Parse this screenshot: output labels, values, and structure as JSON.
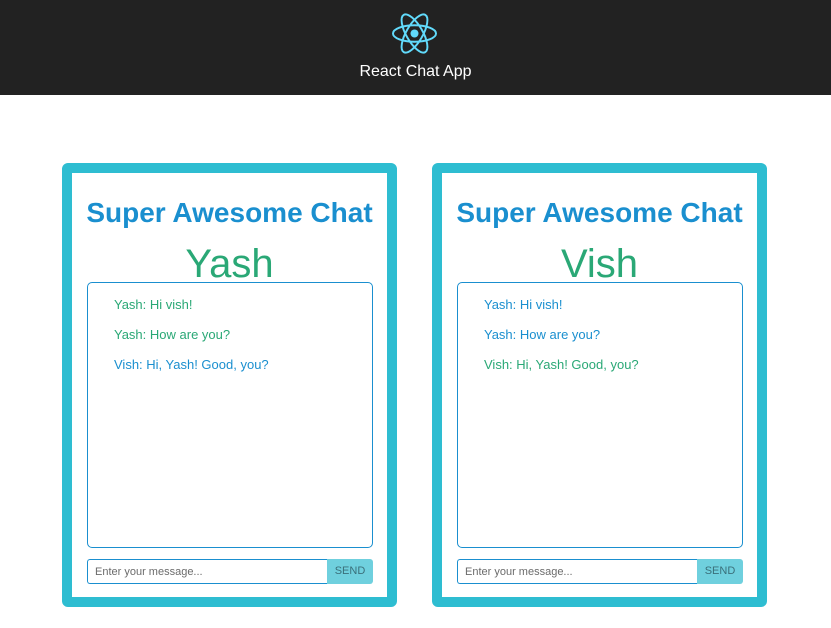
{
  "header": {
    "title": "React Chat App",
    "logo_icon": "react-atom-icon",
    "background": "#222222",
    "logo_color": "#61dafb"
  },
  "colors": {
    "card_border": "#2ebdd1",
    "heading": "#1a8fcf",
    "user_name": "#2aa876",
    "send_button": "#6fd0de"
  },
  "chats": [
    {
      "heading": "Super Awesome Chat",
      "user": "Yash",
      "messages": [
        {
          "text": "Yash: Hi vish!",
          "sender": "Yash"
        },
        {
          "text": "Yash: How are you?",
          "sender": "Yash"
        },
        {
          "text": "Vish: Hi, Yash! Good, you?",
          "sender": "Vish"
        }
      ],
      "input_placeholder": "Enter your message...",
      "input_value": "",
      "send_label": "SEND"
    },
    {
      "heading": "Super Awesome Chat",
      "user": "Vish",
      "messages": [
        {
          "text": "Yash: Hi vish!",
          "sender": "Yash"
        },
        {
          "text": "Yash: How are you?",
          "sender": "Yash"
        },
        {
          "text": "Vish: Hi, Yash! Good, you?",
          "sender": "Vish"
        }
      ],
      "input_placeholder": "Enter your message...",
      "input_value": "",
      "send_label": "SEND"
    }
  ]
}
